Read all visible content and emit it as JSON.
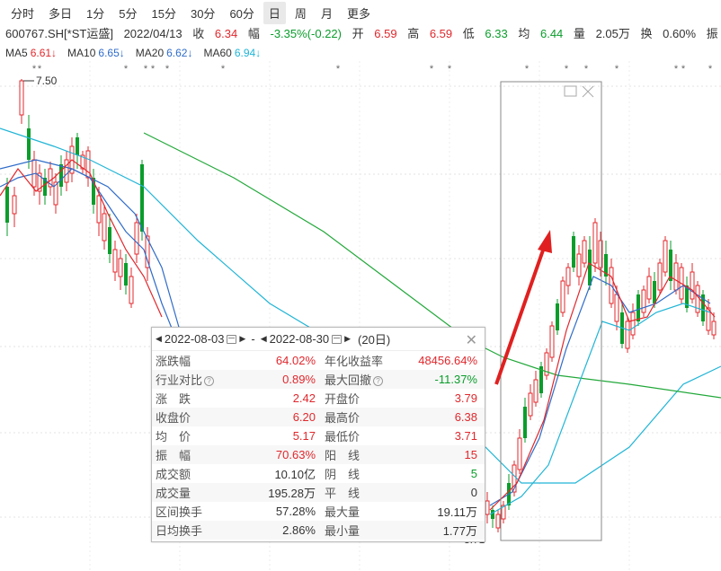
{
  "toolbar": {
    "timeframes": [
      "分时",
      "多日",
      "1分",
      "5分",
      "15分",
      "30分",
      "60分",
      "日",
      "周",
      "月",
      "更多"
    ],
    "active_index": 7
  },
  "info": {
    "stock": "600767.SH[*ST运盛]",
    "date": "2022/04/13",
    "close_label": "收",
    "close": "6.34",
    "change_label": "幅",
    "change": "-3.35%(-0.22)",
    "open_label": "开",
    "open": "6.59",
    "high_label": "高",
    "high": "6.59",
    "low_label": "低",
    "low": "6.33",
    "avg_label": "均",
    "avg": "6.44",
    "vol_label": "量",
    "vol": "2.05万",
    "turnover_label": "换",
    "turnover": "0.60%",
    "extra": "振"
  },
  "ma": [
    {
      "label": "MA5",
      "value": "6.61↓",
      "color": "#e0282d"
    },
    {
      "label": "MA10",
      "value": "6.65↓",
      "color": "#2f6cc9"
    },
    {
      "label": "MA20",
      "value": "6.62↓",
      "color": "#2f6cc9"
    },
    {
      "label": "MA60",
      "value": "6.94↓",
      "color": "#20b5d6"
    }
  ],
  "chart_labels": {
    "high_mark": "7.50",
    "low_mark": "3.71"
  },
  "popup": {
    "start_date": "2022-08-03",
    "end_date": "2022-08-30",
    "separator": "-",
    "days": "(20日)",
    "rows": [
      {
        "l1": "涨跌幅",
        "v1": "64.02%",
        "c1": "red",
        "l2": "年化收益率",
        "v2": "48456.64%",
        "c2": "red",
        "h1": false,
        "h2": false
      },
      {
        "l1": "行业对比",
        "v1": "0.89%",
        "c1": "red",
        "l2": "最大回撤",
        "v2": "-11.37%",
        "c2": "green",
        "h1": true,
        "h2": true
      },
      {
        "l1": "涨　跌",
        "v1": "2.42",
        "c1": "red",
        "l2": "开盘价",
        "v2": "3.79",
        "c2": "red",
        "h1": false,
        "h2": false
      },
      {
        "l1": "收盘价",
        "v1": "6.20",
        "c1": "red",
        "l2": "最高价",
        "v2": "6.38",
        "c2": "red",
        "h1": false,
        "h2": false
      },
      {
        "l1": "均　价",
        "v1": "5.17",
        "c1": "red",
        "l2": "最低价",
        "v2": "3.71",
        "c2": "red",
        "h1": false,
        "h2": false
      },
      {
        "l1": "振　幅",
        "v1": "70.63%",
        "c1": "red",
        "l2": "阳　线",
        "v2": "15",
        "c2": "red",
        "h1": false,
        "h2": false
      },
      {
        "l1": "成交额",
        "v1": "10.10亿",
        "c1": "dark",
        "l2": "阴　线",
        "v2": "5",
        "c2": "green",
        "h1": false,
        "h2": false
      },
      {
        "l1": "成交量",
        "v1": "195.28万",
        "c1": "dark",
        "l2": "平　线",
        "v2": "0",
        "c2": "dark",
        "h1": false,
        "h2": false
      },
      {
        "l1": "区间换手",
        "v1": "57.28%",
        "c1": "dark",
        "l2": "最大量",
        "v2": "19.11万",
        "c2": "dark",
        "h1": false,
        "h2": false
      },
      {
        "l1": "日均换手",
        "v1": "2.86%",
        "c1": "dark",
        "l2": "最小量",
        "v2": "1.77万",
        "c2": "dark",
        "h1": false,
        "h2": false
      }
    ]
  },
  "colors": {
    "up": "#e0282d",
    "down": "#0a9d2b",
    "ma5": "#e0282d",
    "ma10": "#2f6cc9",
    "ma20": "#2f6cc9",
    "ma60": "#20b5d6",
    "ma120": "#22a83a"
  }
}
